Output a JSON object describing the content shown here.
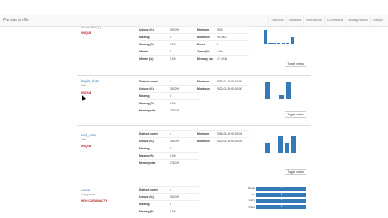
{
  "app": {
    "title": "Pandas profile"
  },
  "nav": {
    "links": [
      "Overview",
      "Variables",
      "Interactions",
      "Correlations",
      "Missing values",
      "Sample"
    ]
  },
  "cards": [
    {
      "name": "Not identified (_)",
      "type": "",
      "badge": "UNIQUE",
      "stats_left": [
        {
          "k": "Unique (%)",
          "v": "100.0%"
        },
        {
          "k": "Missing",
          "v": "0"
        },
        {
          "k": "Missing (%)",
          "v": "0.0%"
        },
        {
          "k": "Infinite",
          "v": "0"
        },
        {
          "k": "Infinite (%)",
          "v": "0.0%"
        }
      ],
      "stats_right": [
        {
          "k": "Minimum",
          "v": "2000"
        },
        {
          "k": "Maximum",
          "v": "24-2004"
        },
        {
          "k": "Zeros",
          "v": "0"
        },
        {
          "k": "Zeros (%)",
          "v": "0.0%"
        },
        {
          "k": "Memory size",
          "v": "17.6 KiB"
        }
      ],
      "chart_data": {
        "type": "bar",
        "categories": [
          "",
          "",
          "",
          "",
          "",
          "",
          ""
        ],
        "values": [
          8,
          1,
          1,
          1,
          1,
          1,
          4
        ],
        "ylim": [
          0,
          10
        ]
      },
      "toggle": "Toggle details"
    },
    {
      "name": "begin_date",
      "type": "Date",
      "badge": "UNIQUE",
      "stats_left": [
        {
          "k": "Distinct count",
          "v": "4"
        },
        {
          "k": "Unique (%)",
          "v": "100.0%"
        },
        {
          "k": "Missing",
          "v": "0"
        },
        {
          "k": "Missing (%)",
          "v": "0.0%"
        },
        {
          "k": "Memory size",
          "v": "176.0 B"
        }
      ],
      "stats_right": [
        {
          "k": "Minimum",
          "v": "2013-01-25 00:00:00"
        },
        {
          "k": "Maximum",
          "v": "2020-03-20 00:00:00"
        }
      ],
      "chart_data": {
        "type": "bar",
        "categories": [
          "",
          "",
          "",
          ""
        ],
        "values": [
          10,
          0,
          2,
          10
        ],
        "ylim": [
          0,
          10
        ]
      },
      "toggle": "Toggle details"
    },
    {
      "name": "end_date",
      "type": "Date",
      "badge": "UNIQUE",
      "stats_left": [
        {
          "k": "Distinct count",
          "v": "4"
        },
        {
          "k": "Unique (%)",
          "v": "100.0%"
        },
        {
          "k": "Missing",
          "v": "0"
        },
        {
          "k": "Missing (%)",
          "v": "0.0%"
        },
        {
          "k": "Memory size",
          "v": "176.0 B"
        }
      ],
      "stats_right": [
        {
          "k": "Minimum",
          "v": "2015-08-20 00:01:01"
        },
        {
          "k": "Maximum",
          "v": "2020-05-20 00:00:01"
        }
      ],
      "chart_data": {
        "type": "bar",
        "categories": [
          "",
          "",
          "",
          "",
          ""
        ],
        "values": [
          6,
          0,
          10,
          6,
          10
        ],
        "ylim": [
          0,
          10
        ]
      },
      "toggle": "Toggle details"
    },
    {
      "name": "name",
      "type": "Categorical",
      "badge": "HIGH CARDINALITY",
      "stats_left": [
        {
          "k": "Distinct count",
          "v": "4"
        },
        {
          "k": "Unique (%)",
          "v": "100.0%"
        },
        {
          "k": "Missing",
          "v": "0"
        },
        {
          "k": "Missing (%)",
          "v": "0.0%"
        }
      ],
      "chart_data": {
        "type": "bar",
        "orientation": "horizontal",
        "categories": [
          "Name",
          "Not",
          "Carry",
          "Other"
        ],
        "values": [
          1,
          1,
          1,
          1
        ]
      }
    }
  ]
}
